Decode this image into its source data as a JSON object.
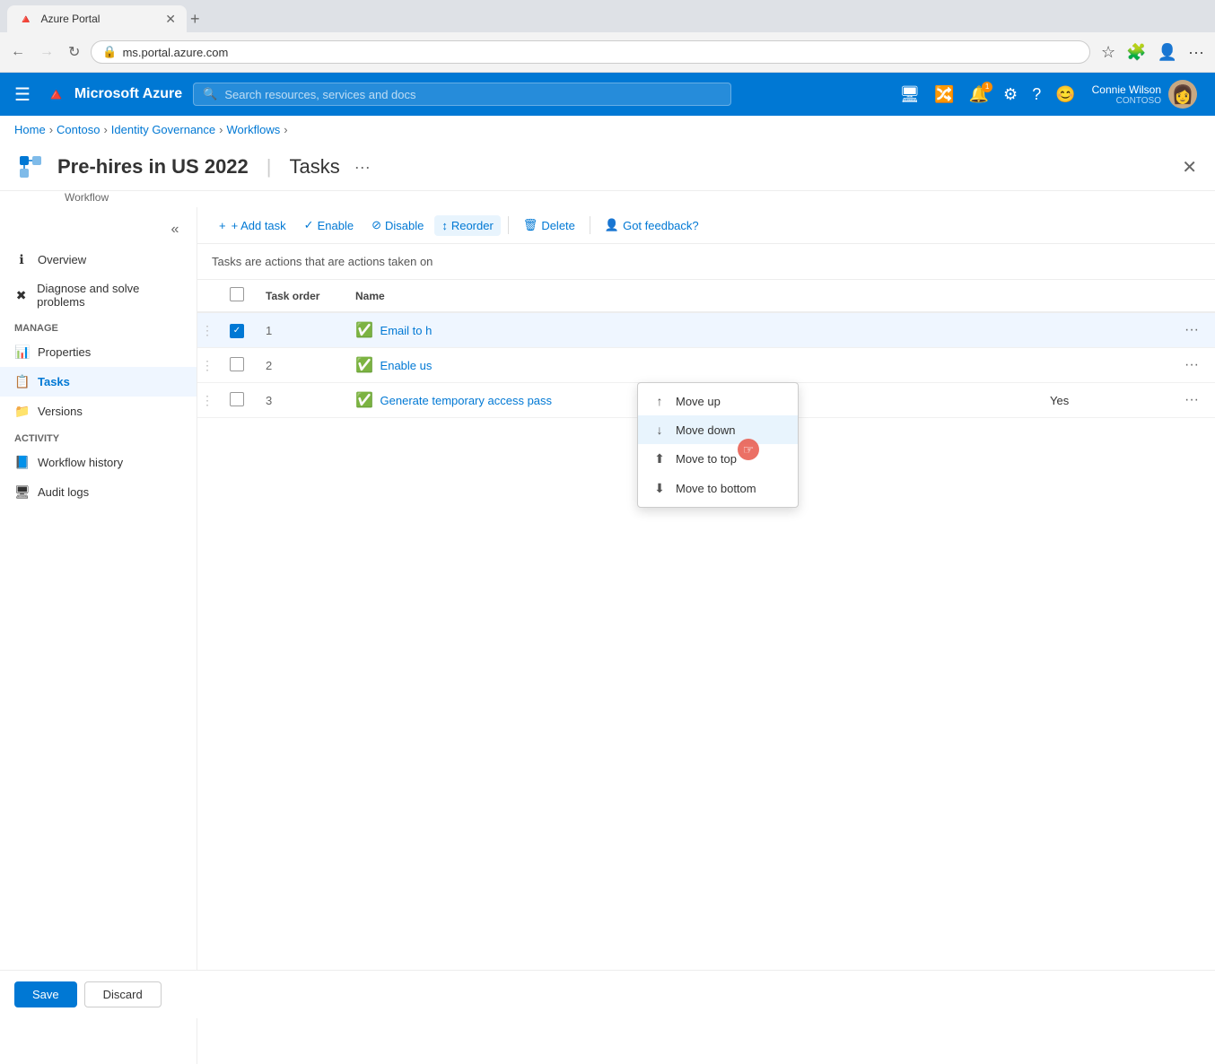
{
  "browser": {
    "tab_title": "Azure Portal",
    "tab_icon": "🔺",
    "url": "ms.portal.azure.com",
    "nav_back_disabled": false,
    "nav_forward_disabled": true
  },
  "header": {
    "menu_icon": "☰",
    "logo_text": "Microsoft Azure",
    "search_placeholder": "Search resources, services and docs",
    "user_name": "Connie Wilson",
    "user_org": "CONTOSO"
  },
  "breadcrumb": {
    "items": [
      "Home",
      "Contoso",
      "Identity Governance",
      "Workflows"
    ]
  },
  "page": {
    "title": "Pre-hires in US 2022",
    "subtitle": "Tasks",
    "workflow_label": "Workflow",
    "more_icon": "···"
  },
  "toolbar": {
    "add_task_label": "+ Add task",
    "enable_label": "Enable",
    "disable_label": "Disable",
    "reorder_label": "Reorder",
    "delete_label": "Delete",
    "feedback_label": "Got feedback?"
  },
  "description": "Tasks are actions that are actions taken on",
  "table": {
    "columns": [
      "",
      "",
      "Task order",
      "Name",
      ""
    ],
    "rows": [
      {
        "order": "1",
        "name": "Email to h",
        "enabled": true,
        "checked": true,
        "enabled_text": ""
      },
      {
        "order": "2",
        "name": "Enable us",
        "enabled": true,
        "checked": false,
        "enabled_text": ""
      },
      {
        "order": "3",
        "name": "Generate temporary access pass",
        "enabled": true,
        "checked": false,
        "enabled_text": "Yes"
      }
    ]
  },
  "reorder_menu": {
    "items": [
      {
        "label": "Move up",
        "icon": "↑"
      },
      {
        "label": "Move down",
        "icon": "↓"
      },
      {
        "label": "Move to top",
        "icon": "⤒"
      },
      {
        "label": "Move to bottom",
        "icon": "⤓"
      }
    ],
    "active_item": "Move down"
  },
  "sidebar": {
    "manage_label": "Manage",
    "manage_items": [
      {
        "label": "Properties",
        "icon": "📊"
      },
      {
        "label": "Tasks",
        "icon": "📋",
        "active": true
      },
      {
        "label": "Versions",
        "icon": "📁"
      }
    ],
    "activity_label": "Activity",
    "activity_items": [
      {
        "label": "Workflow history",
        "icon": "📘"
      },
      {
        "label": "Audit logs",
        "icon": "🖥"
      }
    ],
    "top_items": [
      {
        "label": "Overview",
        "icon": "ℹ"
      },
      {
        "label": "Diagnose and solve problems",
        "icon": "✖"
      }
    ]
  },
  "bottom_bar": {
    "save_label": "Save",
    "discard_label": "Discard"
  },
  "colors": {
    "azure_blue": "#0078d4",
    "active_bg": "#eff6ff",
    "green_check": "#107c10",
    "selected_row": "#ddeeff"
  }
}
